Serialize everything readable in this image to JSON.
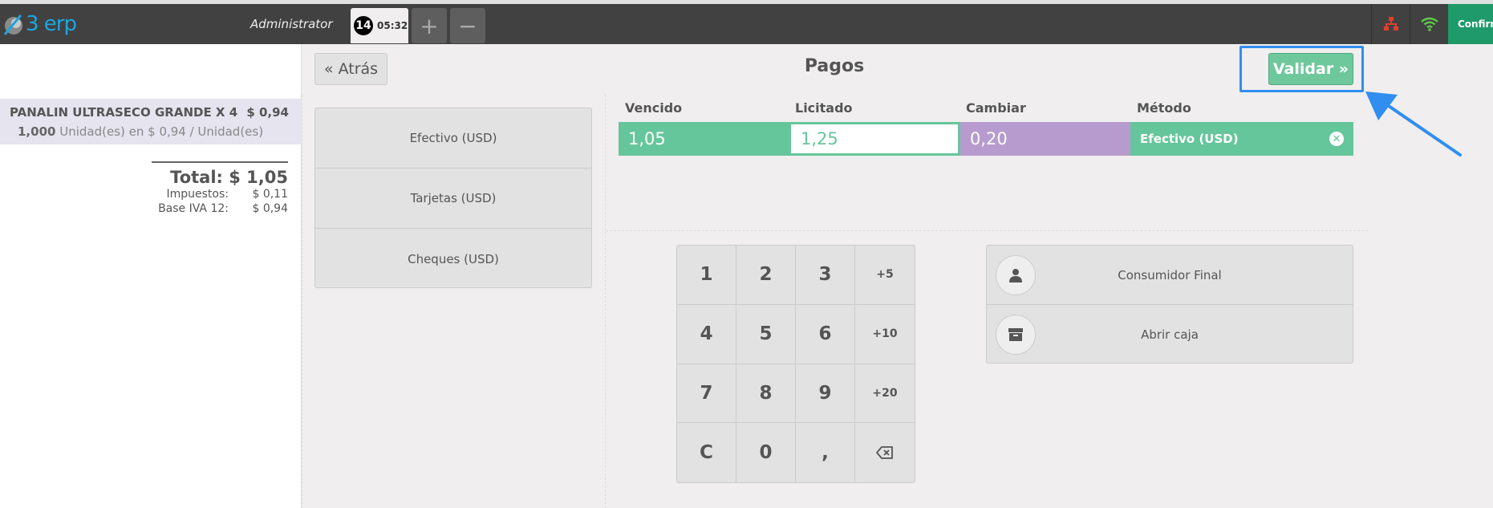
{
  "header": {
    "logo_text": "3 erp",
    "user": "Administrator",
    "order_tab": {
      "number": "14",
      "time": "05:32"
    },
    "add_label": "+",
    "remove_label": "−",
    "confirm_label": "Confirm"
  },
  "order": {
    "line": {
      "product": "PANALIN ULTRASECO GRANDE X 4",
      "price": "$ 0,94",
      "quantity": "1,000",
      "detail": " Unidad(es) en $ 0,94 / Unidad(es)"
    },
    "total": "Total: $ 1,05",
    "taxes_label": "Impuestos:",
    "taxes_value": "$ 0,11",
    "base_label": "Base IVA 12:",
    "base_value": "$ 0,94"
  },
  "payment": {
    "back_label": "« Atrás",
    "title": "Pagos",
    "validate_label": "Validar »",
    "methods": [
      "Efectivo (USD)",
      "Tarjetas (USD)",
      "Cheques (USD)"
    ],
    "columns": {
      "due": "Vencido",
      "tendered": "Licitado",
      "change": "Cambiar",
      "method": "Método"
    },
    "line": {
      "due": "1,05",
      "tendered": "1,25",
      "change": "0,20",
      "method": "Efectivo (USD)"
    },
    "numpad": [
      "1",
      "2",
      "3",
      "+5",
      "4",
      "5",
      "6",
      "+10",
      "7",
      "8",
      "9",
      "+20",
      "C",
      "0",
      ","
    ],
    "customer_label": "Consumidor Final",
    "open_cashbox_label": "Abrir caja"
  },
  "colors": {
    "accent_green": "#66c69b",
    "change_purple": "#b89bce",
    "highlight_blue": "#2f8ef0",
    "topbar": "#414141"
  }
}
